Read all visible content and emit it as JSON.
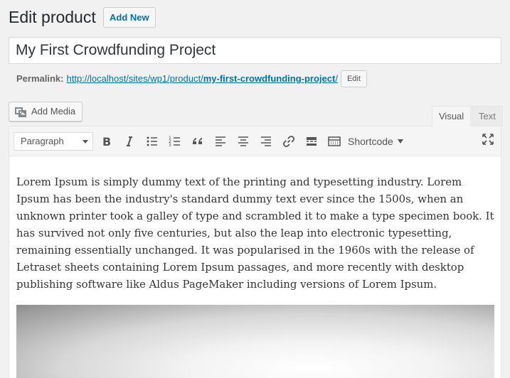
{
  "header": {
    "title": "Edit product",
    "add_new_label": "Add New"
  },
  "post": {
    "title_value": "My First Crowdfunding Project"
  },
  "permalink": {
    "label": "Permalink:",
    "url_base": "http://localhost/sites/wp1/product/",
    "url_slug": "my-first-crowdfunding-project",
    "url_end": "/",
    "edit_label": "Edit"
  },
  "media": {
    "add_media_label": "Add Media"
  },
  "editor": {
    "tabs": [
      {
        "label": "Visual",
        "active": true
      },
      {
        "label": "Text",
        "active": false
      }
    ],
    "format_select_value": "Paragraph",
    "toolbar_icons": [
      "bold-icon",
      "italic-icon",
      "bulleted-list-icon",
      "numbered-list-icon",
      "blockquote-icon",
      "align-left-icon",
      "align-center-icon",
      "align-right-icon",
      "link-icon",
      "read-more-icon",
      "toolbar-toggle-icon",
      "fullscreen-icon"
    ],
    "shortcode_label": "Shortcode",
    "content_text": "Lorem Ipsum is simply dummy text of the printing and typesetting industry. Lorem Ipsum has been the industry's standard dummy text ever since the 1500s, when an unknown printer took a galley of type and scrambled it to make a type specimen book. It has survived not only five centuries, but also the leap into electronic typesetting, remaining essentially unchanged. It was popularised in the 1960s with the release of Letraset sheets containing Lorem Ipsum passages, and more recently with desktop publishing software like Aldus PageMaker including versions of Lorem Ipsum."
  },
  "colors": {
    "link": "#0073aa",
    "background": "#f1f1f1",
    "toolbar": "#f5f5f5"
  }
}
